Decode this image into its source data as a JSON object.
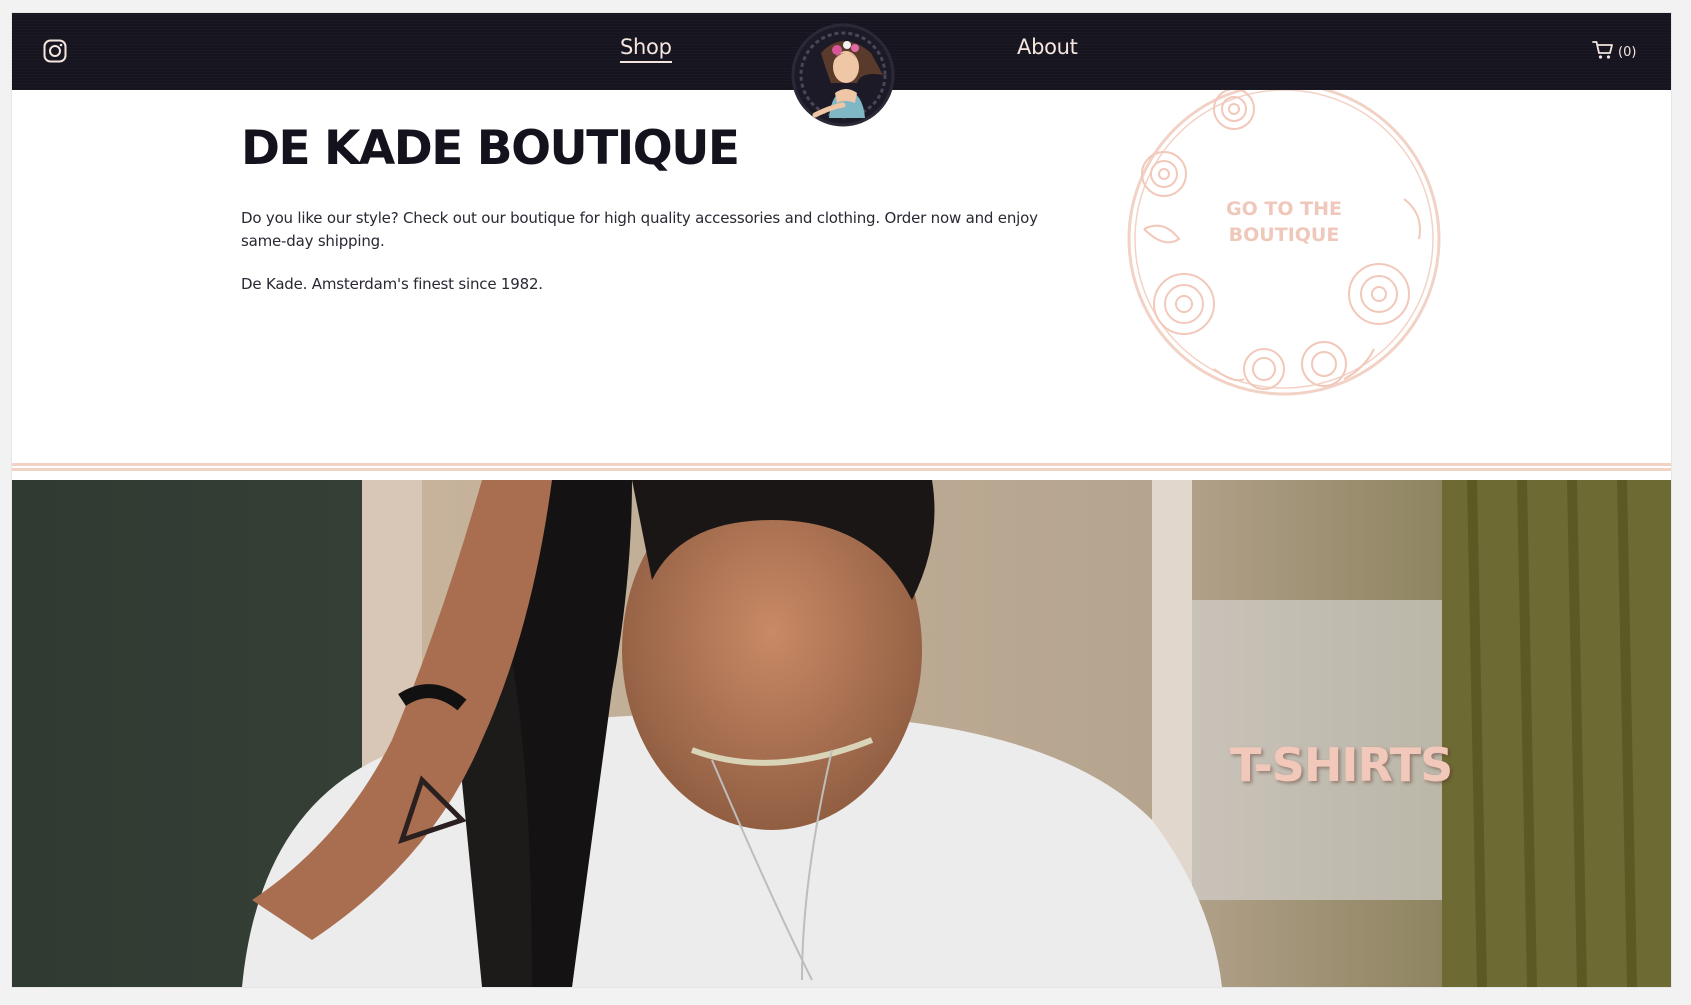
{
  "nav": {
    "instagram_icon": "instagram-icon",
    "links": [
      {
        "label": "Shop",
        "active": true
      },
      {
        "label": "About",
        "active": false
      }
    ],
    "cart_icon": "cart-icon",
    "cart_count": "(0)"
  },
  "hero": {
    "title": "DE KADE BOUTIQUE",
    "text": "Do you like our style? Check out our boutique for high quality accessories and clothing. Order now and enjoy same-day shipping.",
    "tagline": "De Kade. Amsterdam's finest since 1982."
  },
  "boutique_link": {
    "label_line1": "GO TO THE",
    "label_line2": "BOUTIQUE"
  },
  "banner": {
    "label": "T-SHIRTS"
  },
  "colors": {
    "nav_bg": "#16141f",
    "accent_pink": "#f3d2c6",
    "nav_text": "#f4e6df",
    "heading": "#14121c"
  }
}
